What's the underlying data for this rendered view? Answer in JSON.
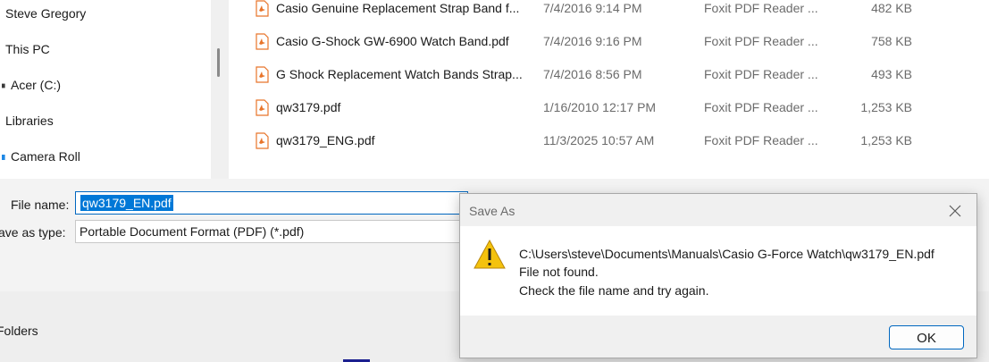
{
  "nav": {
    "items": [
      "Steve Gregory",
      "This PC",
      "Acer (C:)",
      "Libraries",
      "Camera Roll"
    ]
  },
  "files": [
    {
      "name": "Casio Genuine Replacement Strap Band f...",
      "date": "7/4/2016 9:14 PM",
      "type": "Foxit PDF Reader ...",
      "size": "482 KB"
    },
    {
      "name": "Casio G-Shock GW-6900 Watch Band.pdf",
      "date": "7/4/2016 9:16 PM",
      "type": "Foxit PDF Reader ...",
      "size": "758 KB"
    },
    {
      "name": "G Shock Replacement Watch Bands Strap...",
      "date": "7/4/2016 8:56 PM",
      "type": "Foxit PDF Reader ...",
      "size": "493 KB"
    },
    {
      "name": "qw3179.pdf",
      "date": "1/16/2010 12:17 PM",
      "type": "Foxit PDF Reader ...",
      "size": "1,253 KB"
    },
    {
      "name": "qw3179_ENG.pdf",
      "date": "11/3/2025 10:57 AM",
      "type": "Foxit PDF Reader ...",
      "size": "1,253 KB"
    }
  ],
  "form": {
    "file_name_label": "File name:",
    "file_name_value": "qw3179_EN.pdf",
    "save_type_label": "ave as type:",
    "save_type_value": "Portable Document Format (PDF) (*.pdf)",
    "folders_label": "Folders"
  },
  "dialog": {
    "title": "Save As",
    "path": "C:\\Users\\steve\\Documents\\Manuals\\Casio G-Force Watch\\qw3179_EN.pdf",
    "line2": "File not found.",
    "line3": "Check the file name and try again.",
    "ok_label": "OK"
  },
  "colors": {
    "accent": "#0067c0",
    "selection": "#0078d7",
    "warning": "#f4c20d",
    "pdf_icon": "#e8742a"
  }
}
